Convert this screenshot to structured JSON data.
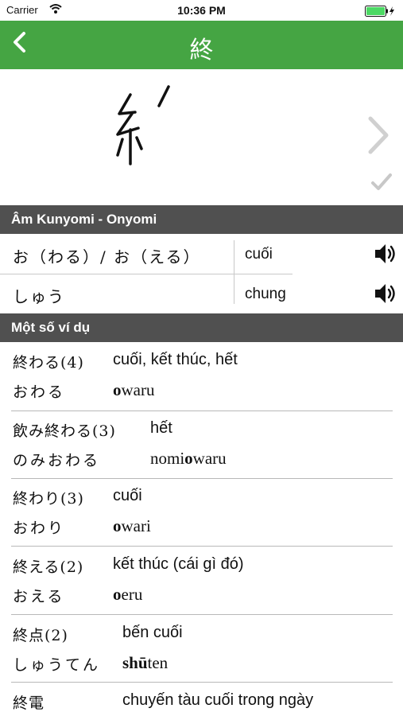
{
  "status": {
    "carrier": "Carrier",
    "time": "10:36 PM"
  },
  "nav": {
    "title": "終"
  },
  "sections": {
    "readings": "Âm Kunyomi - Onyomi",
    "examples": "Một số ví dụ"
  },
  "readings": [
    {
      "jp": "お（わる）/ お（える）",
      "vn": "cuối"
    },
    {
      "jp": "しゅう",
      "vn": "chung"
    }
  ],
  "examples": [
    {
      "kanji": "終わる(4)",
      "kana": "おわる",
      "meaning": "cuối, kết thúc, hết",
      "romaji_bold": "o",
      "romaji_rest": "waru",
      "romaji_pre": ""
    },
    {
      "kanji": "飲み終わる(3)",
      "kana": "のみおわる",
      "meaning": "hết",
      "romaji_pre": "nomi",
      "romaji_bold": "o",
      "romaji_rest": "waru"
    },
    {
      "kanji": "終わり(3)",
      "kana": "おわり",
      "meaning": "cuối",
      "romaji_pre": "",
      "romaji_bold": "o",
      "romaji_rest": "wari"
    },
    {
      "kanji": "終える(2)",
      "kana": "おえる",
      "meaning": "kết thúc (cái gì đó)",
      "romaji_pre": "",
      "romaji_bold": "o",
      "romaji_rest": "eru"
    },
    {
      "kanji": "終点(2)",
      "kana": "しゅうてん",
      "meaning": "bến cuối",
      "romaji_pre": "",
      "romaji_bold": "shū",
      "romaji_rest": "ten"
    },
    {
      "kanji": "終電",
      "kana": "",
      "meaning": "chuyến tàu cuối trong ngày",
      "romaji_pre": "",
      "romaji_bold": "",
      "romaji_rest": ""
    }
  ]
}
